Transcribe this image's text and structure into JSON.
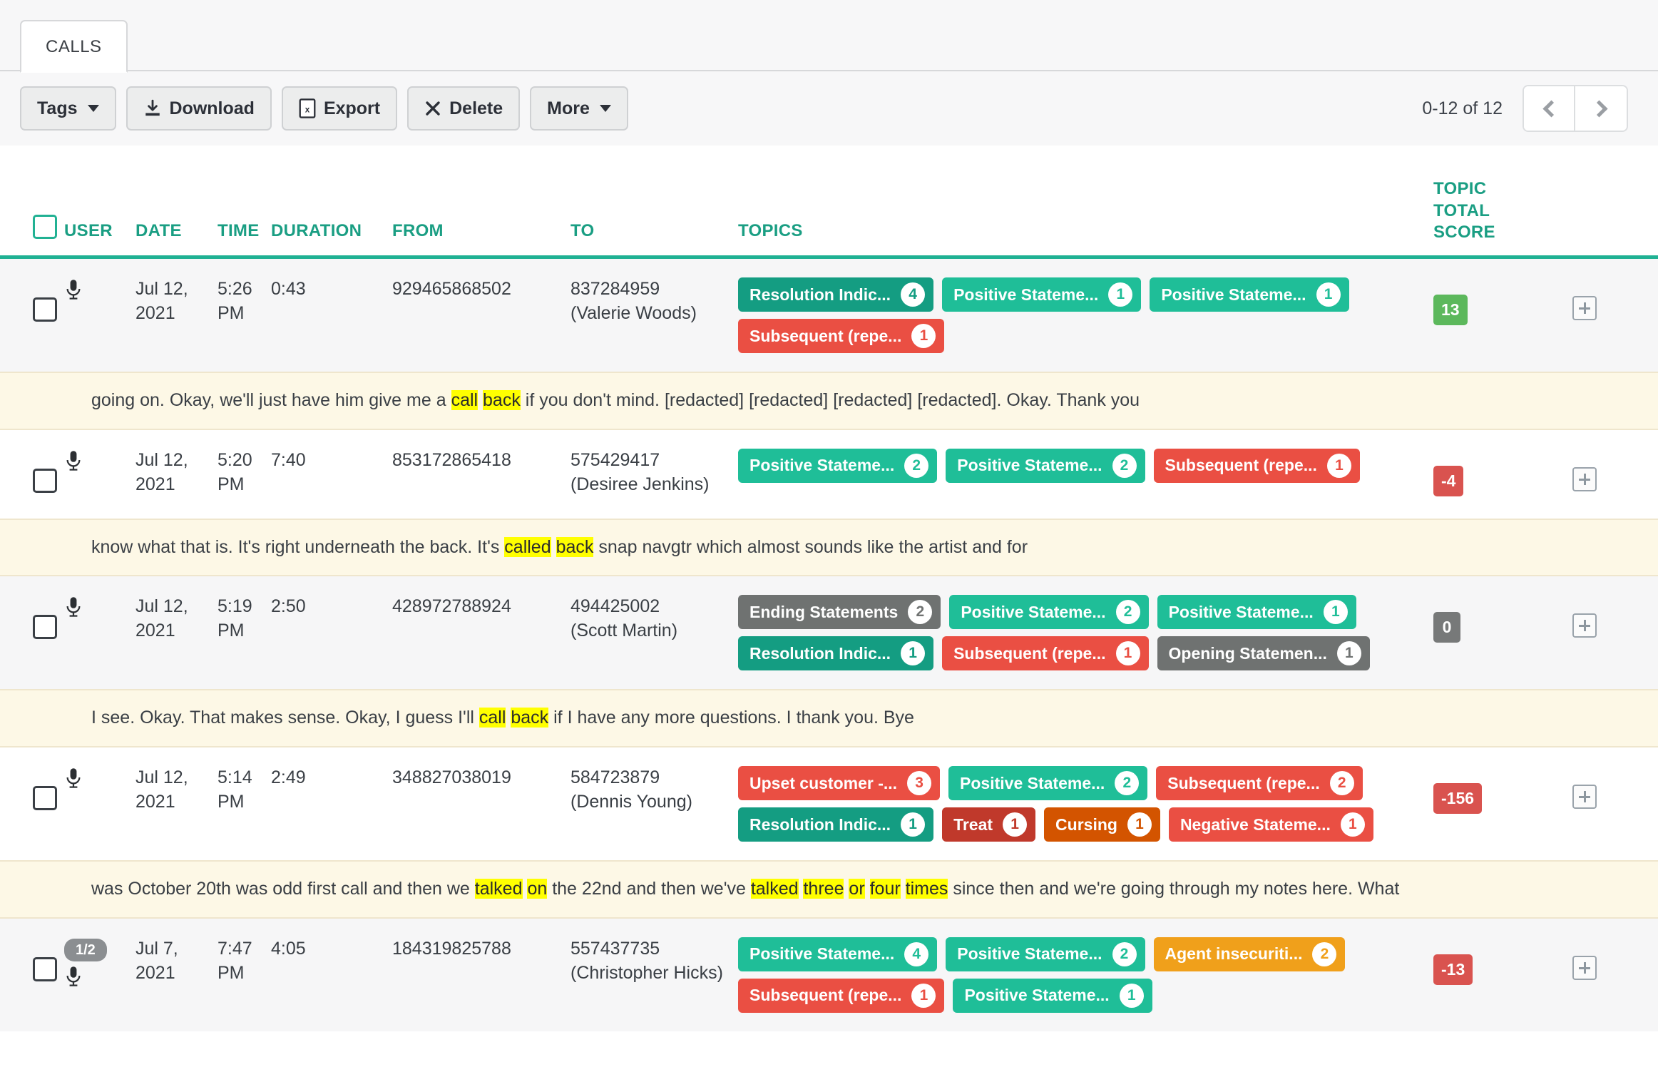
{
  "tabs": [
    {
      "label": "CALLS",
      "active": true
    }
  ],
  "toolbar": {
    "tags_label": "Tags",
    "download_label": "Download",
    "export_label": "Export",
    "delete_label": "Delete",
    "more_label": "More"
  },
  "pagination": {
    "range_text": "0-12 of 12",
    "prev_icon": "chevron-left-icon",
    "next_icon": "chevron-right-icon"
  },
  "table": {
    "headers": {
      "user": "USER",
      "date": "DATE",
      "time": "TIME",
      "duration": "DURATION",
      "from": "FROM",
      "to": "TO",
      "topics": "TOPICS",
      "score_line1": "TOPIC",
      "score_line2": "TOTAL",
      "score_line3": "SCORE"
    },
    "rows": [
      {
        "user_badge": null,
        "date": "Jul 12, 2021",
        "time": "5:26 PM",
        "duration": "0:43",
        "from": "929465868502",
        "to_number": "837284959",
        "to_name": "(Valerie Woods)",
        "topics": [
          {
            "label": "Resolution Indic...",
            "count": "4",
            "color": "dteal"
          },
          {
            "label": "Positive Stateme...",
            "count": "1",
            "color": "teal"
          },
          {
            "label": "Positive Stateme...",
            "count": "1",
            "color": "teal"
          },
          {
            "label": "Subsequent (repe...",
            "count": "1",
            "color": "red"
          }
        ],
        "score": "13",
        "score_color": "green",
        "transcript": [
          {
            "t": "going on. Okay, we'll just have him give me a ",
            "hl": false
          },
          {
            "t": "call",
            "hl": true
          },
          {
            "t": " ",
            "hl": false
          },
          {
            "t": "back",
            "hl": true
          },
          {
            "t": " if you don't mind. [redacted] [redacted] [redacted] [redacted]. Okay. Thank you",
            "hl": false
          }
        ]
      },
      {
        "user_badge": null,
        "date": "Jul 12, 2021",
        "time": "5:20 PM",
        "duration": "7:40",
        "from": "853172865418",
        "to_number": "575429417",
        "to_name": "(Desiree Jenkins)",
        "topics": [
          {
            "label": "Positive Stateme...",
            "count": "2",
            "color": "teal"
          },
          {
            "label": "Positive Stateme...",
            "count": "2",
            "color": "teal"
          },
          {
            "label": "Subsequent (repe...",
            "count": "1",
            "color": "red"
          }
        ],
        "score": "-4",
        "score_color": "red",
        "transcript": [
          {
            "t": "know what that is. It's right underneath the back. It's ",
            "hl": false
          },
          {
            "t": "called",
            "hl": true
          },
          {
            "t": " ",
            "hl": false
          },
          {
            "t": "back",
            "hl": true
          },
          {
            "t": " snap navgtr which almost sounds like the artist and for",
            "hl": false
          }
        ]
      },
      {
        "user_badge": null,
        "date": "Jul 12, 2021",
        "time": "5:19 PM",
        "duration": "2:50",
        "from": "428972788924",
        "to_number": "494425002",
        "to_name": "(Scott Martin)",
        "topics": [
          {
            "label": "Ending Statements",
            "count": "2",
            "color": "gray"
          },
          {
            "label": "Positive Stateme...",
            "count": "2",
            "color": "teal"
          },
          {
            "label": "Positive Stateme...",
            "count": "1",
            "color": "teal"
          },
          {
            "label": "Resolution Indic...",
            "count": "1",
            "color": "dteal"
          },
          {
            "label": "Subsequent (repe...",
            "count": "1",
            "color": "red"
          },
          {
            "label": "Opening Statemen...",
            "count": "1",
            "color": "gray"
          }
        ],
        "score": "0",
        "score_color": "gray",
        "transcript": [
          {
            "t": "I see. Okay. That makes sense. Okay, I guess I'll ",
            "hl": false
          },
          {
            "t": "call",
            "hl": true
          },
          {
            "t": " ",
            "hl": false
          },
          {
            "t": "back",
            "hl": true
          },
          {
            "t": " if I have any more questions. I thank you. Bye",
            "hl": false
          }
        ]
      },
      {
        "user_badge": null,
        "date": "Jul 12, 2021",
        "time": "5:14 PM",
        "duration": "2:49",
        "from": "348827038019",
        "to_number": "584723879",
        "to_name": "(Dennis Young)",
        "topics": [
          {
            "label": "Upset customer -...",
            "count": "3",
            "color": "red"
          },
          {
            "label": "Positive Stateme...",
            "count": "2",
            "color": "teal"
          },
          {
            "label": "Subsequent (repe...",
            "count": "2",
            "color": "red"
          },
          {
            "label": "Resolution Indic...",
            "count": "1",
            "color": "dteal"
          },
          {
            "label": "Treat",
            "count": "1",
            "color": "brick"
          },
          {
            "label": "Cursing",
            "count": "1",
            "color": "burnt"
          },
          {
            "label": "Negative Stateme...",
            "count": "1",
            "color": "red"
          }
        ],
        "score": "-156",
        "score_color": "red",
        "transcript": [
          {
            "t": "was October 20th was odd first call and then we ",
            "hl": false
          },
          {
            "t": "talked",
            "hl": true
          },
          {
            "t": " ",
            "hl": false
          },
          {
            "t": "on",
            "hl": true
          },
          {
            "t": " the 22nd and then we've ",
            "hl": false
          },
          {
            "t": "talked",
            "hl": true
          },
          {
            "t": " ",
            "hl": false
          },
          {
            "t": "three",
            "hl": true
          },
          {
            "t": " ",
            "hl": false
          },
          {
            "t": "or",
            "hl": true
          },
          {
            "t": " ",
            "hl": false
          },
          {
            "t": "four",
            "hl": true
          },
          {
            "t": " ",
            "hl": false
          },
          {
            "t": "times",
            "hl": true
          },
          {
            "t": " since then and we're going through my notes here. What",
            "hl": false
          }
        ]
      },
      {
        "user_badge": "1/2",
        "date": "Jul 7, 2021",
        "time": "7:47 PM",
        "duration": "4:05",
        "from": "184319825788",
        "to_number": "557437735",
        "to_name": "(Christopher Hicks)",
        "topics": [
          {
            "label": "Positive Stateme...",
            "count": "4",
            "color": "teal"
          },
          {
            "label": "Positive Stateme...",
            "count": "2",
            "color": "teal"
          },
          {
            "label": "Agent insecuriti...",
            "count": "2",
            "color": "orange"
          },
          {
            "label": "Subsequent (repe...",
            "count": "1",
            "color": "red"
          },
          {
            "label": "Positive Stateme...",
            "count": "1",
            "color": "teal"
          }
        ],
        "score": "-13",
        "score_color": "red",
        "transcript": null
      }
    ]
  },
  "colors": {
    "accent_teal": "#1a9e83",
    "tag_teal": "#1fbe98",
    "tag_dark_teal": "#149d82",
    "tag_red": "#ea4f43",
    "tag_gray": "#6f7271",
    "tag_brick": "#c0392b",
    "tag_orange": "#f0a01b",
    "tag_burnt_orange": "#d35400",
    "score_green": "#5cb85c",
    "score_red": "#d9534f",
    "highlight_yellow": "#ffff00",
    "transcript_bg": "#fdf8e6"
  },
  "icons": {
    "mic": "microphone-icon",
    "download": "download-icon",
    "export": "spreadsheet-icon",
    "delete": "x-icon",
    "expand": "plus-square-icon",
    "checkbox": "checkbox-icon"
  }
}
